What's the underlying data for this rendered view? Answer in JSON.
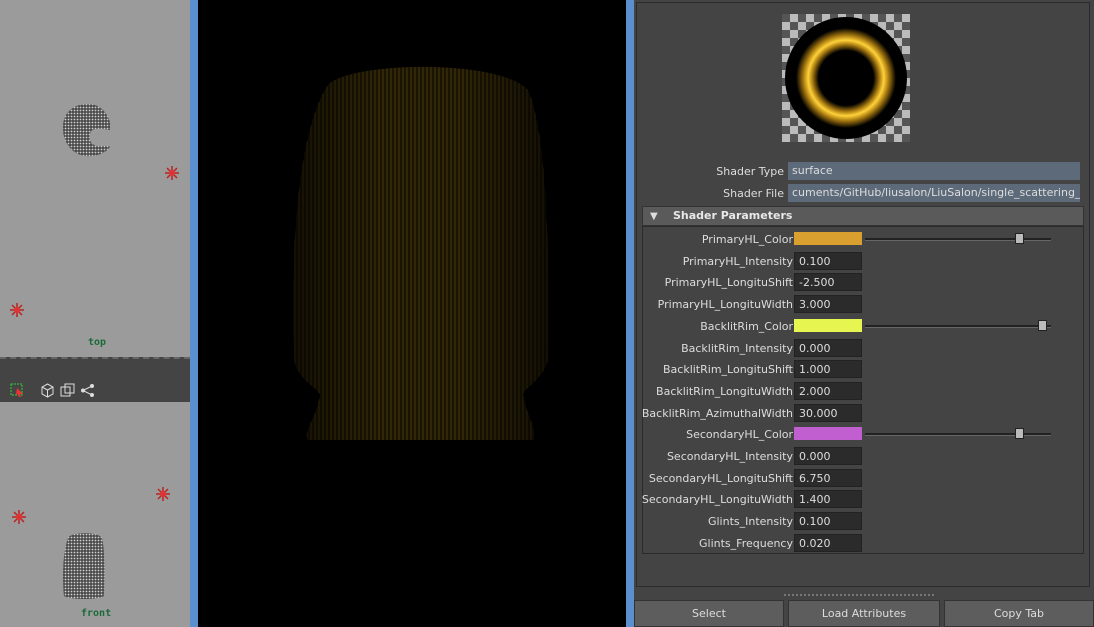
{
  "viewports": {
    "top_label": "top",
    "front_label": "front"
  },
  "shader": {
    "type_label": "Shader Type",
    "type_value": "surface",
    "file_label": "Shader File",
    "file_value": "cuments/GitHub/liusalon/LiuSalon/single_scattering_AFC.sdl"
  },
  "section": {
    "title": "Shader Parameters"
  },
  "params": [
    {
      "label": "PrimaryHL_Color",
      "kind": "color",
      "color": "#d9a030",
      "slider": 0.83
    },
    {
      "label": "PrimaryHL_Intensity",
      "kind": "value",
      "value": "0.100"
    },
    {
      "label": "PrimaryHL_LongituShift",
      "kind": "value",
      "value": "-2.500"
    },
    {
      "label": "PrimaryHL_LongituWidth",
      "kind": "value",
      "value": "3.000"
    },
    {
      "label": "BacklitRim_Color",
      "kind": "color",
      "color": "#e6f550",
      "slider": 0.95
    },
    {
      "label": "BacklitRim_Intensity",
      "kind": "value",
      "value": "0.000"
    },
    {
      "label": "BacklitRim_LongituShift",
      "kind": "value",
      "value": "1.000"
    },
    {
      "label": "BacklitRim_LongituWidth",
      "kind": "value",
      "value": "2.000"
    },
    {
      "label": "BacklitRim_AzimuthalWidth",
      "kind": "value",
      "value": "30.000"
    },
    {
      "label": "SecondaryHL_Color",
      "kind": "color",
      "color": "#c25fd0",
      "slider": 0.83
    },
    {
      "label": "SecondaryHL_Intensity",
      "kind": "value",
      "value": "0.000"
    },
    {
      "label": "SecondaryHL_LongituShift",
      "kind": "value",
      "value": "6.750"
    },
    {
      "label": "SecondaryHL_LongituWidth",
      "kind": "value",
      "value": "1.400"
    },
    {
      "label": "Glints_Intensity",
      "kind": "value",
      "value": "0.100"
    },
    {
      "label": "Glints_Frequency",
      "kind": "value",
      "value": "0.020"
    }
  ],
  "buttons": {
    "select": "Select",
    "load_attributes": "Load Attributes",
    "copy_tab": "Copy Tab"
  },
  "icons": [
    "light-icon",
    "select-tool-icon",
    "cube-icon",
    "frame-icon",
    "share-icon",
    "shader-swatch-icon"
  ]
}
